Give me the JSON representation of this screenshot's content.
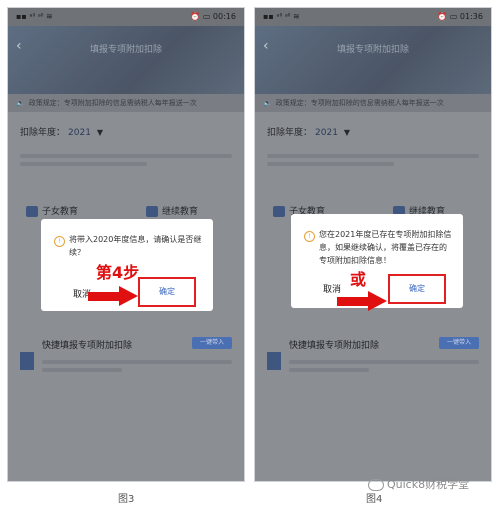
{
  "left_phone": {
    "status_left": "▪▪ ᵃˡˡ ᵃˡˡ ≋",
    "status_right": "⏰ ▭ 00:16",
    "title": "填报专项附加扣除",
    "notice": "政策规定：专项附加扣除的信息需纳税人每年报送一次",
    "year_label": "扣除年度：",
    "year_value": "2021",
    "grid": [
      "子女教育",
      "继续教育"
    ],
    "quick_title": "快捷填报专项附加扣除",
    "quick_button": "一键带入",
    "dialog_message": "将带入2020年度信息，请确认是否继续？",
    "cancel": "取消",
    "confirm": "确定",
    "annotation": "第4步",
    "caption": "图3"
  },
  "right_phone": {
    "status_left": "▪▪ ᵃˡˡ ᵃˡˡ ≋",
    "status_right": "⏰ ▭ 01:36",
    "title": "填报专项附加扣除",
    "notice": "政策规定：专项附加扣除的信息需纳税人每年报送一次",
    "year_label": "扣除年度：",
    "year_value": "2021",
    "grid": [
      "子女教育",
      "继续教育"
    ],
    "quick_title": "快捷填报专项附加扣除",
    "quick_button": "一键带入",
    "dialog_message": "您在2021年度已存在专项附加扣除信息，如果继续确认，将覆盖已存在的专项附加扣除信息！",
    "cancel": "取消",
    "confirm": "确定",
    "annotation": "或",
    "caption": "图4"
  },
  "watermark": "Quick8财税学堂",
  "colors": {
    "arrow": "#e01010",
    "highlight": "#e02020",
    "link": "#3a67c0"
  }
}
